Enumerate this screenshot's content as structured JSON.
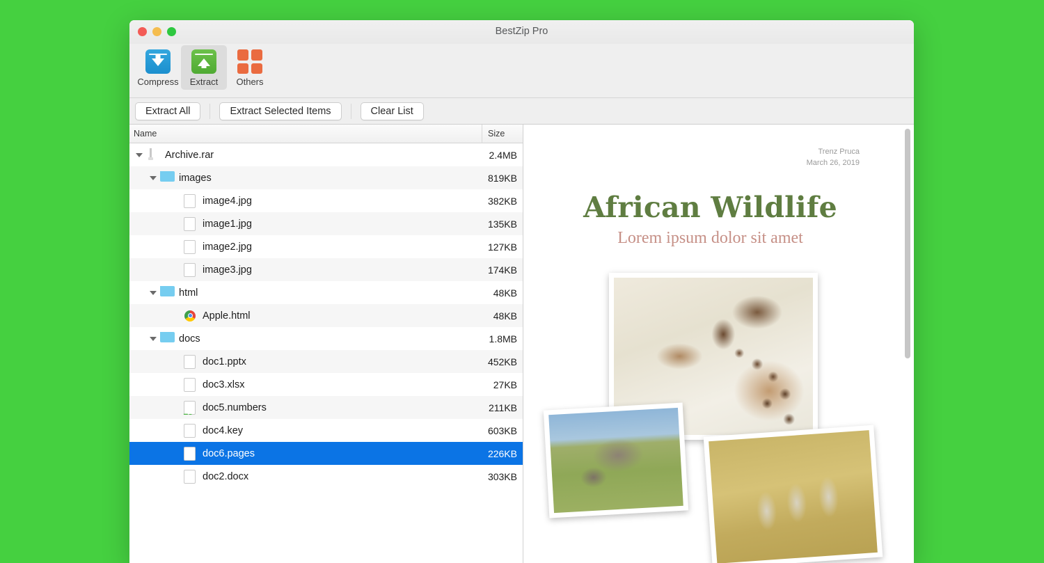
{
  "window": {
    "title": "BestZip Pro",
    "traffic_lights": [
      {
        "name": "close",
        "color": "#f35b56"
      },
      {
        "name": "minimize",
        "color": "#f5bd4f"
      },
      {
        "name": "maximize",
        "color": "#2ec840"
      }
    ]
  },
  "toolbar": {
    "items": [
      {
        "label": "Compress",
        "icon": "compress-box-down-arrow-icon",
        "active": false
      },
      {
        "label": "Extract",
        "icon": "extract-box-up-arrow-icon",
        "active": true
      },
      {
        "label": "Others",
        "icon": "grid-squares-icon",
        "active": false
      }
    ]
  },
  "action_bar": {
    "buttons": [
      {
        "label": "Extract All"
      },
      {
        "label": "Extract Selected Items"
      },
      {
        "label": "Clear List"
      }
    ]
  },
  "file_list": {
    "columns": {
      "name": "Name",
      "size": "Size"
    },
    "rows": [
      {
        "name": "Archive.rar",
        "size": "2.4MB",
        "indent": 0,
        "icon": "rar-archive-icon",
        "twisty": "open",
        "selected": false
      },
      {
        "name": "images",
        "size": "819KB",
        "indent": 1,
        "icon": "folder-icon",
        "twisty": "open",
        "selected": false
      },
      {
        "name": "image4.jpg",
        "size": "382KB",
        "indent": 2,
        "icon": "jpg-image-icon",
        "twisty": "none",
        "selected": false
      },
      {
        "name": "image1.jpg",
        "size": "135KB",
        "indent": 2,
        "icon": "jpg-image-icon",
        "twisty": "none",
        "selected": false
      },
      {
        "name": "image2.jpg",
        "size": "127KB",
        "indent": 2,
        "icon": "jpg-image-icon",
        "twisty": "none",
        "selected": false
      },
      {
        "name": "image3.jpg",
        "size": "174KB",
        "indent": 2,
        "icon": "jpg-image-icon",
        "twisty": "none",
        "selected": false
      },
      {
        "name": "html",
        "size": "48KB",
        "indent": 1,
        "icon": "folder-icon",
        "twisty": "open",
        "selected": false
      },
      {
        "name": "Apple.html",
        "size": "48KB",
        "indent": 2,
        "icon": "chrome-html-icon",
        "twisty": "none",
        "selected": false
      },
      {
        "name": "docs",
        "size": "1.8MB",
        "indent": 1,
        "icon": "folder-icon",
        "twisty": "open",
        "selected": false
      },
      {
        "name": "doc1.pptx",
        "size": "452KB",
        "indent": 2,
        "icon": "powerpoint-icon",
        "twisty": "none",
        "selected": false
      },
      {
        "name": "doc3.xlsx",
        "size": "27KB",
        "indent": 2,
        "icon": "excel-icon",
        "twisty": "none",
        "selected": false
      },
      {
        "name": "doc5.numbers",
        "size": "211KB",
        "indent": 2,
        "icon": "numbers-icon",
        "twisty": "none",
        "selected": false
      },
      {
        "name": "doc4.key",
        "size": "603KB",
        "indent": 2,
        "icon": "keynote-icon",
        "twisty": "none",
        "selected": false
      },
      {
        "name": "doc6.pages",
        "size": "226KB",
        "indent": 2,
        "icon": "pages-icon",
        "twisty": "none",
        "selected": true
      },
      {
        "name": "doc2.docx",
        "size": "303KB",
        "indent": 2,
        "icon": "word-icon",
        "twisty": "none",
        "selected": false
      }
    ],
    "selection_color": "#0b74e5"
  },
  "preview": {
    "author": "Trenz Pruca",
    "date": "March 26, 2019",
    "title": "African Wildlife",
    "subtitle": "Lorem ipsum dolor sit amet",
    "title_color": "#5f7d41",
    "subtitle_color": "#c69087",
    "photos": [
      {
        "name": "giraffe-photo"
      },
      {
        "name": "elephants-photo"
      },
      {
        "name": "meerkats-photo"
      }
    ]
  },
  "background_color": "#45d040"
}
